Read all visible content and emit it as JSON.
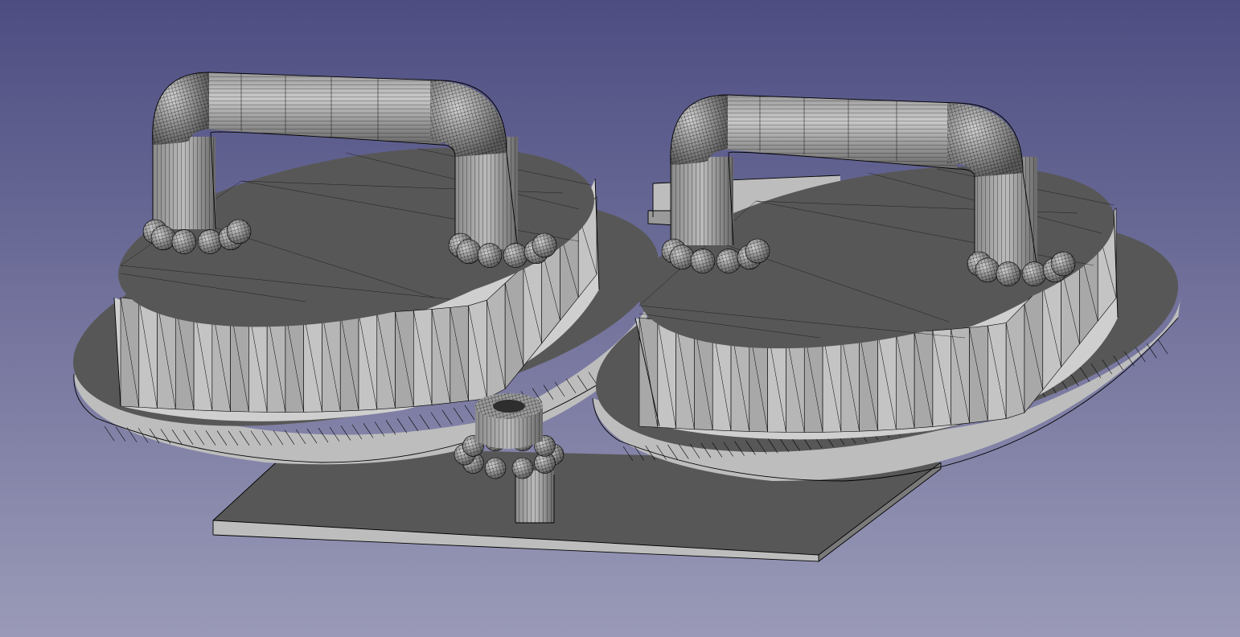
{
  "viewport": {
    "background_top": "#4d4d82",
    "background_bottom": "#9a9ab8",
    "face_dark": "#575757",
    "face_mid": "#8a8a8a",
    "face_light": "#bdbdbd",
    "face_lighter": "#cfcfcf",
    "edge_color": "#000000"
  },
  "scene": {
    "objects": [
      {
        "name": "base-plate"
      },
      {
        "name": "left-disc-flange"
      },
      {
        "name": "left-disc-body"
      },
      {
        "name": "left-handle"
      },
      {
        "name": "right-disc-flange"
      },
      {
        "name": "right-disc-body"
      },
      {
        "name": "right-handle"
      },
      {
        "name": "center-knob"
      },
      {
        "name": "hidden-bracket"
      }
    ]
  }
}
